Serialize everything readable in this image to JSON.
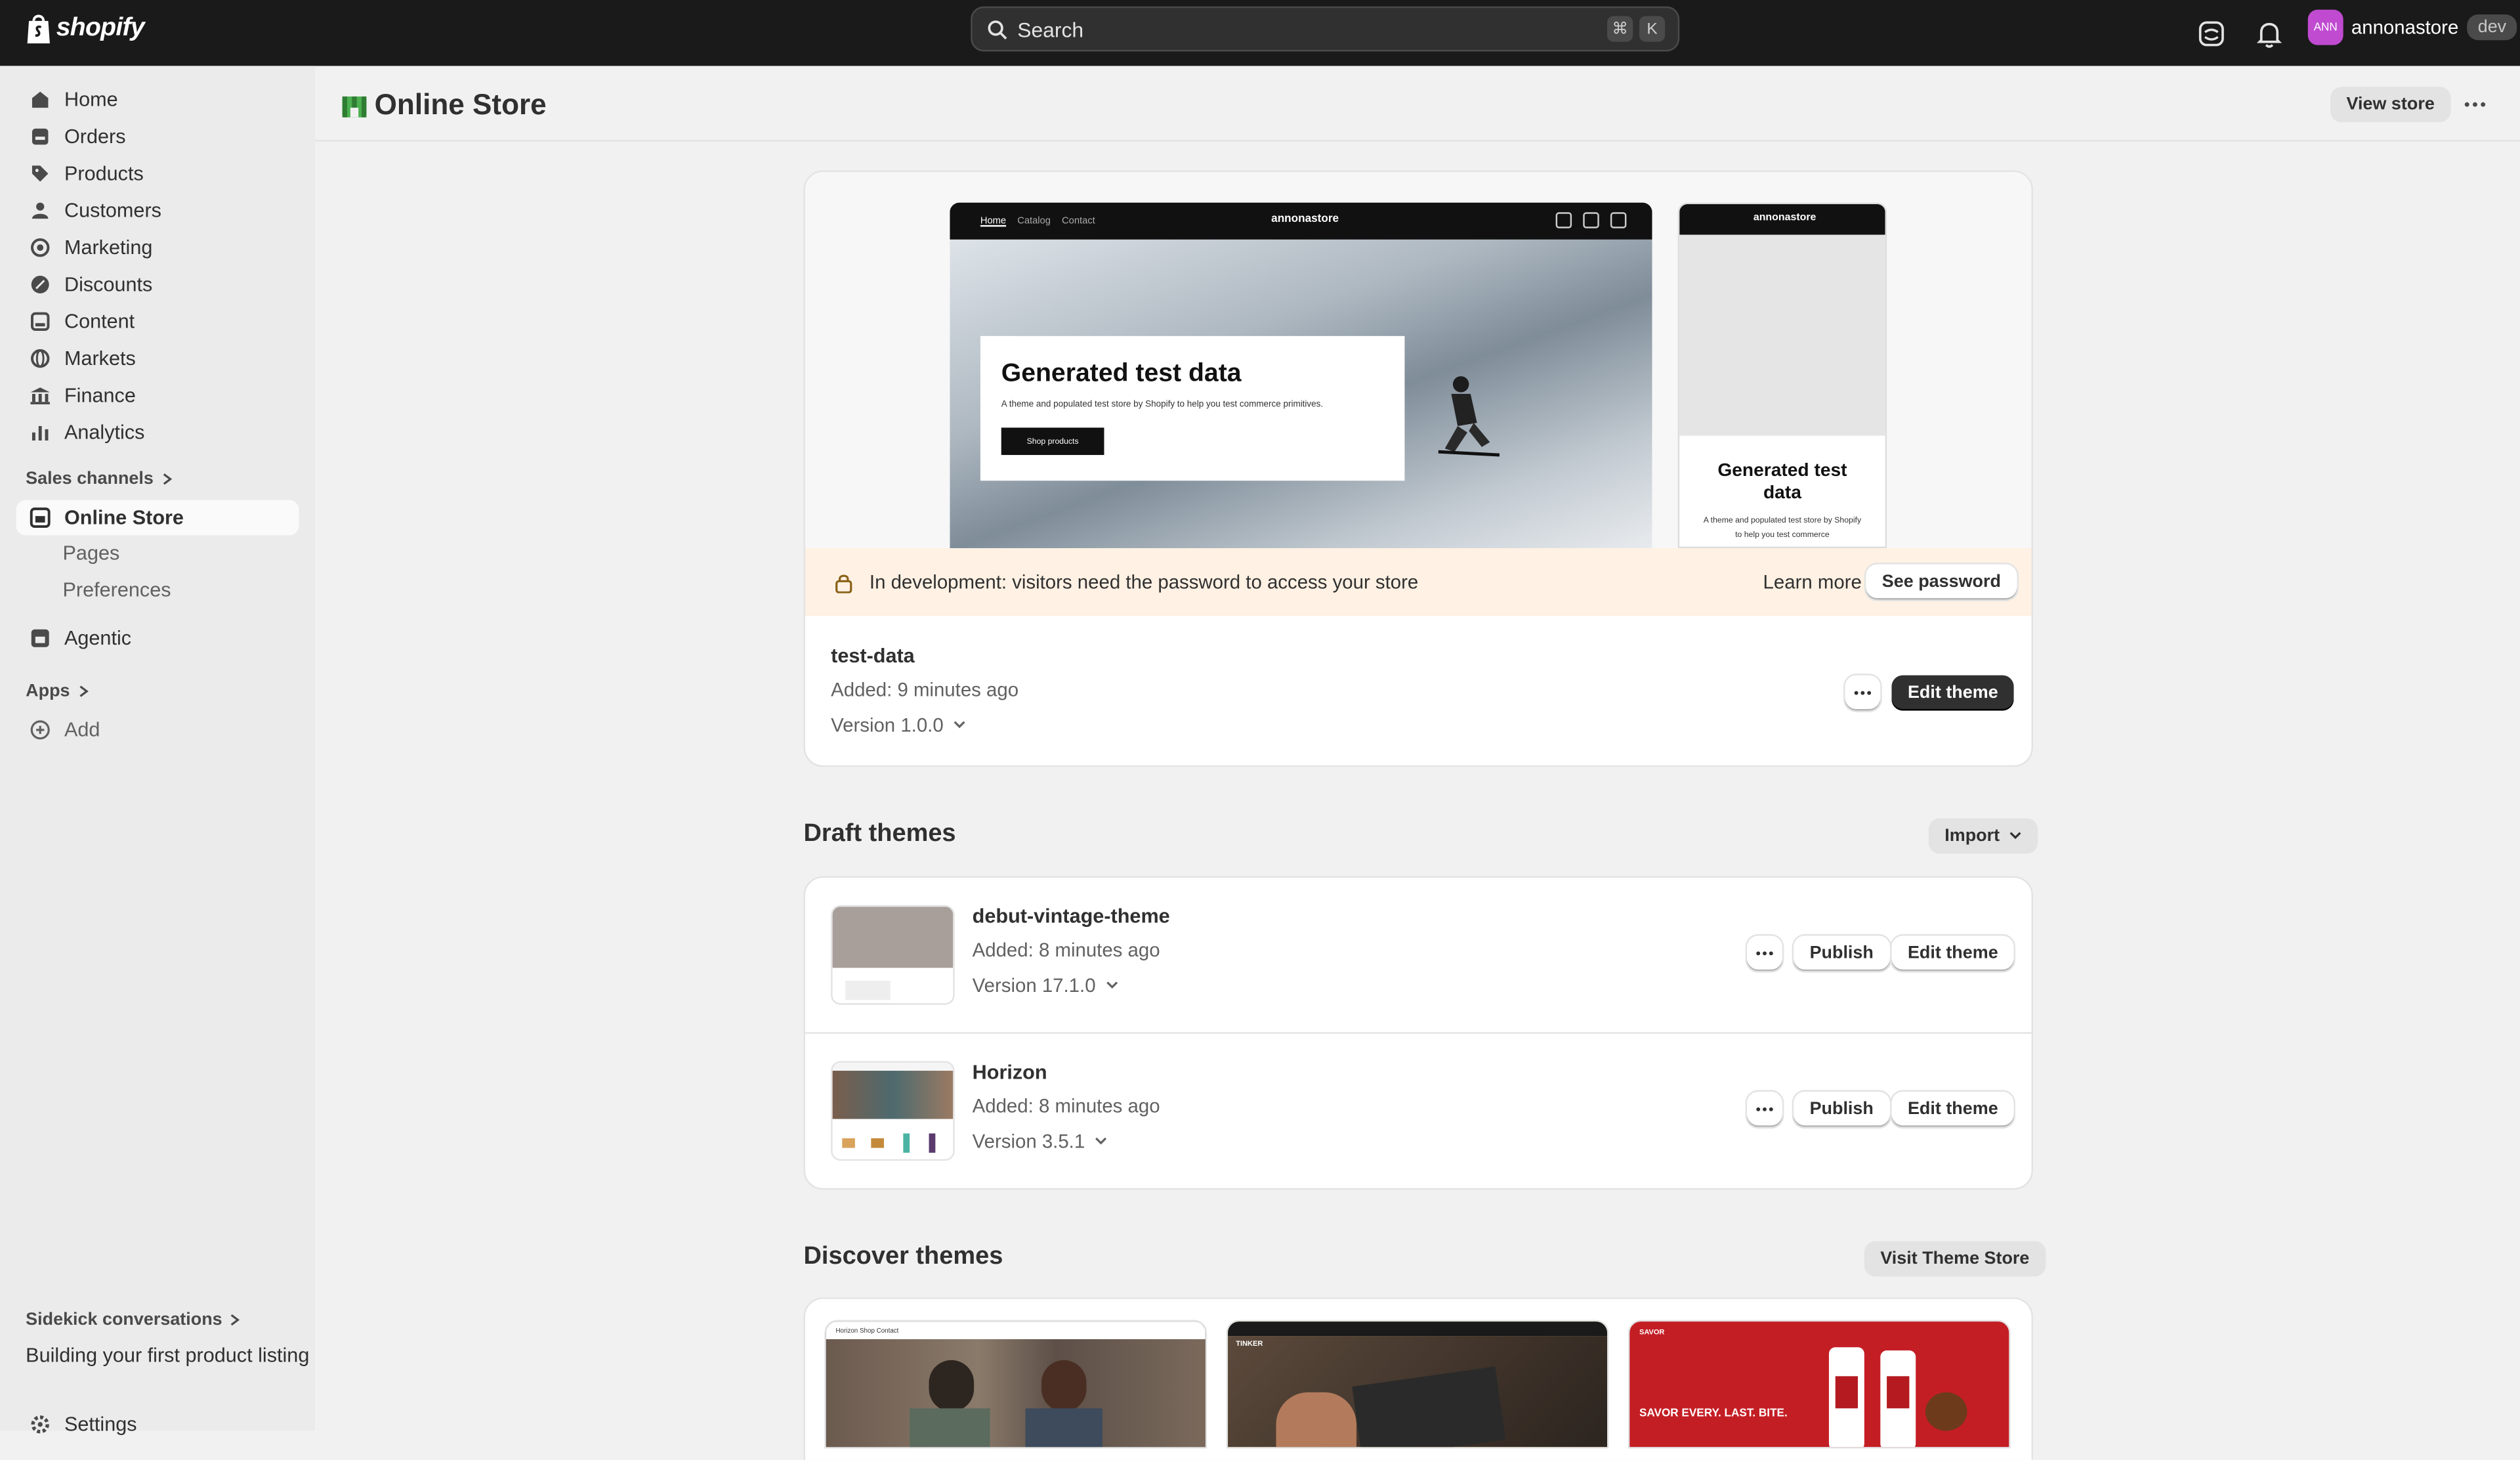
{
  "topbar": {
    "brand": "shopify",
    "search_placeholder": "Search",
    "shortcut_keys": [
      "⌘",
      "K"
    ],
    "avatar_initials": "ANN",
    "store_name": "annonastore",
    "badge": "dev"
  },
  "sidebar": {
    "items": [
      {
        "label": "Home",
        "icon": "home-icon"
      },
      {
        "label": "Orders",
        "icon": "inbox-icon"
      },
      {
        "label": "Products",
        "icon": "tag-icon"
      },
      {
        "label": "Customers",
        "icon": "person-icon"
      },
      {
        "label": "Marketing",
        "icon": "target-icon"
      },
      {
        "label": "Discounts",
        "icon": "discount-icon"
      },
      {
        "label": "Content",
        "icon": "content-icon"
      },
      {
        "label": "Markets",
        "icon": "globe-icon"
      },
      {
        "label": "Finance",
        "icon": "bank-icon"
      },
      {
        "label": "Analytics",
        "icon": "bar-chart-icon"
      }
    ],
    "sales_channels_label": "Sales channels",
    "online_store_label": "Online Store",
    "sub_items": [
      "Pages",
      "Preferences"
    ],
    "agentic_label": "Agentic",
    "apps_label": "Apps",
    "add_label": "Add",
    "sidekick_label": "Sidekick conversations",
    "sidekick_item": "Building your first product listing",
    "settings_label": "Settings"
  },
  "page": {
    "title": "Online Store",
    "view_store": "View store"
  },
  "live_theme": {
    "preview": {
      "nav": [
        "Home",
        "Catalog",
        "Contact"
      ],
      "store_brand": "annonastore",
      "hero_title": "Generated test data",
      "hero_subtitle": "A theme and populated test store by Shopify to help you test commerce primitives.",
      "hero_button": "Shop products",
      "mobile_title": "Generated test data",
      "mobile_subtitle": "A theme and populated test store by Shopify to help you test commerce"
    },
    "banner_text": "In development: visitors need the password to access your store",
    "learn_more": "Learn more",
    "see_password": "See password",
    "name": "test-data",
    "added": "Added: 9 minutes ago",
    "version": "Version 1.0.0",
    "edit_theme": "Edit theme"
  },
  "draft_themes": {
    "title": "Draft themes",
    "import_label": "Import",
    "themes": [
      {
        "name": "debut-vintage-theme",
        "added": "Added: 8 minutes ago",
        "version": "Version 17.1.0",
        "publish": "Publish",
        "edit": "Edit theme"
      },
      {
        "name": "Horizon",
        "added": "Added: 8 minutes ago",
        "version": "Version 3.5.1",
        "publish": "Publish",
        "edit": "Edit theme"
      }
    ]
  },
  "discover": {
    "title": "Discover themes",
    "visit_store": "Visit Theme Store",
    "cards": [
      {
        "brand": "Horizon",
        "nav": "Shop  Contact"
      },
      {
        "brand": "TINKER",
        "nav": ""
      },
      {
        "brand": "SAVOR",
        "tagline": "SAVOR EVERY. LAST. BITE."
      }
    ]
  },
  "colors": {
    "topbar": "#1a1a1a",
    "page_bg": "#f1f1f1",
    "sidebar_bg": "#ebebeb",
    "banner_bg": "#fff1e3",
    "primary_button": "#303030",
    "avatar": "#c04bd1",
    "savor_red": "#c41e25"
  }
}
